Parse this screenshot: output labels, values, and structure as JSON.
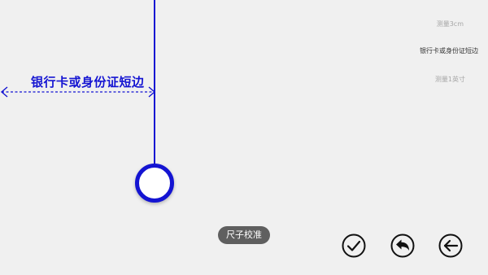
{
  "measure": {
    "label": "银行卡或身份证短边"
  },
  "options": {
    "measure_3cm": "测量3cm",
    "card_edge": "银行卡或身份证短边",
    "measure_1inch": "测量1英寸"
  },
  "calibrate": {
    "label": "尺子校准"
  },
  "icons": {
    "confirm": "checkmark-circle-icon",
    "undo": "undo-arrow-icon",
    "back": "back-arrow-circle-icon"
  },
  "colors": {
    "accent": "#1414d2",
    "background": "#f0f0f0",
    "pill": "#5f5f5f"
  }
}
